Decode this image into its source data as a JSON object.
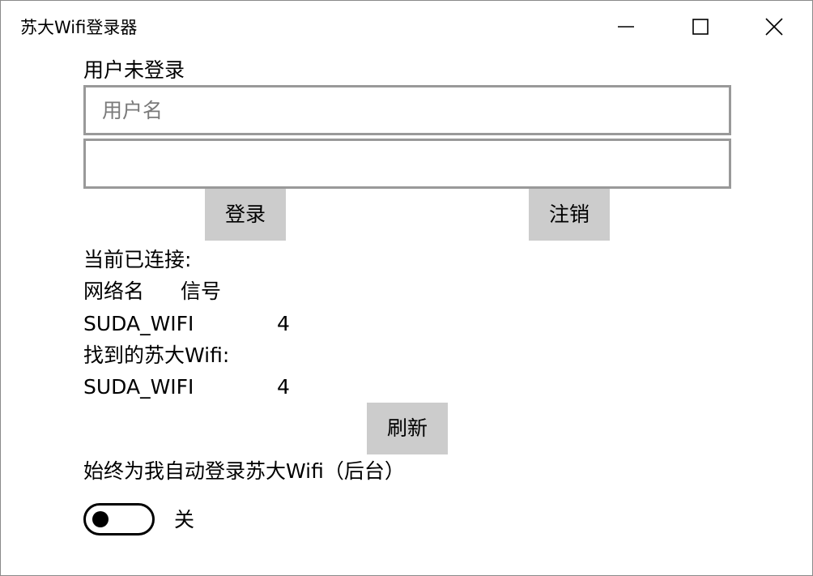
{
  "window": {
    "title": "苏大Wifi登录器"
  },
  "login": {
    "status": "用户未登录",
    "username_placeholder": "用户名",
    "username_value": "",
    "password_value": "",
    "login_label": "登录",
    "logout_label": "注销"
  },
  "connected": {
    "label": "当前已连接:",
    "col_name": "网络名",
    "col_signal": "信号",
    "network": {
      "ssid": "SUDA_WIFI",
      "signal": "4"
    }
  },
  "found": {
    "label": "找到的苏大Wifi:",
    "networks": [
      {
        "ssid": "SUDA_WIFI",
        "signal": "4"
      }
    ],
    "refresh_label": "刷新"
  },
  "auto_login": {
    "label": "始终为我自动登录苏大Wifi（后台）",
    "enabled": false,
    "state_label": "关"
  },
  "icons": {
    "minimize": "minimize-icon",
    "maximize": "maximize-icon",
    "close": "close-icon"
  }
}
